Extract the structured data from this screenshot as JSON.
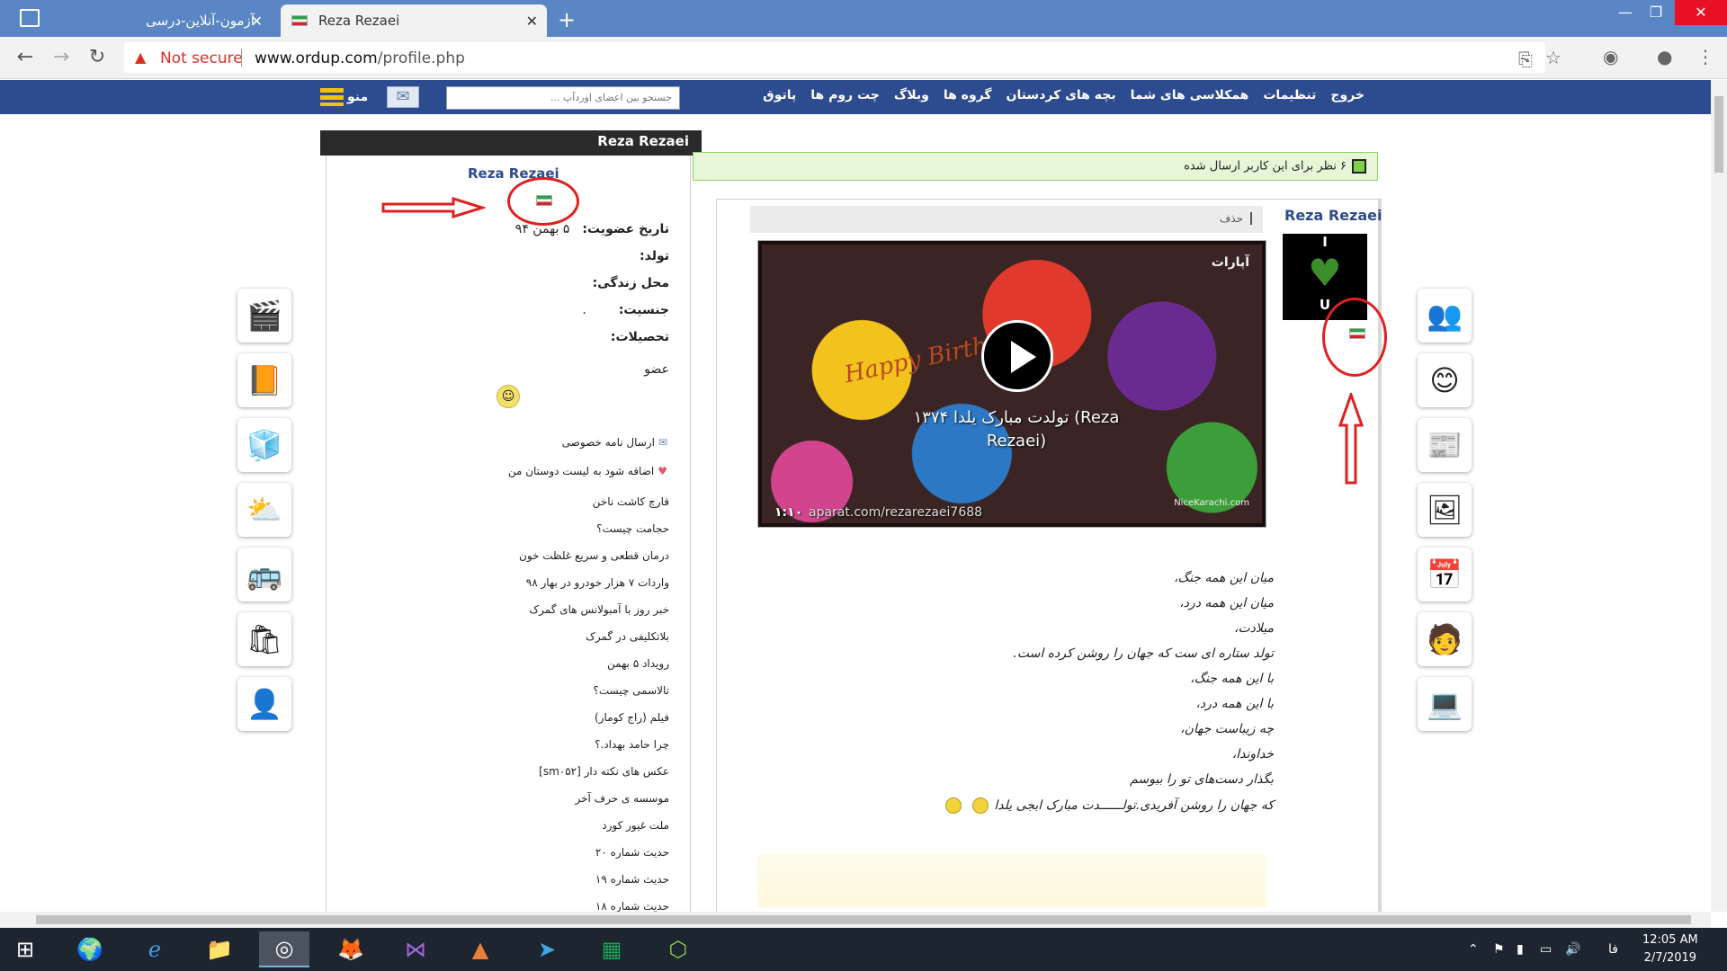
{
  "browser": {
    "tabs": [
      {
        "title": "آزمون-آنلاین-درسی"
      },
      {
        "title": "Reza Rezaei"
      }
    ],
    "security_label": "Not secure",
    "url_host": "www.ordup.com",
    "url_path": "/profile.php"
  },
  "site": {
    "nav_items": [
      "پاتوق",
      "چت روم ها",
      "وبلاگ",
      "گروه ها",
      "بچه های کردستان",
      "همکلاسی های شما",
      "تنظیمات",
      "خروج"
    ],
    "search_placeholder": "جستجو بین اعضای اوردآپ ...",
    "menu_label": "منو"
  },
  "profile": {
    "header_name": "Reza Rezaei",
    "name": "Reza Rezaei",
    "fields": [
      {
        "label": "تاریخ عضویت:",
        "value": "۵ بهمن ۹۴"
      },
      {
        "label": "تولد:",
        "value": ""
      },
      {
        "label": "محل زندگی:",
        "value": ""
      },
      {
        "label": "جنسیت:",
        "value": "."
      },
      {
        "label": "تحصیلات:",
        "value": ""
      }
    ],
    "role": "عضو",
    "send_message": "ارسال نامه خصوصی",
    "add_friend": "اضافه شود به لیست دوستان من",
    "links": [
      "قارچ کاشت ناخن",
      "حجامت چیست؟",
      "درمان قطعی و سریع غلظت خون",
      "واردات ۷ هزار خودرو در بهار ۹۸",
      "خبر روز با آمبولانس های گمرک",
      "بلاتکلیفی در گمرک",
      "رویداد ۵ بهمن",
      "تالاسمی چیست؟",
      "فیلم (راج کومار)",
      "چرا حامد بهداد.؟",
      "عکس های نکته دار [sm۰۵۲]",
      "موسسه ی حرف آخر",
      "ملت غیور کورد",
      "حدیث شماره ۲۰",
      "حدیث شماره ۱۹",
      "حدیث شماره ۱۸"
    ]
  },
  "comments": {
    "notice": "۶ نظر برای این کاربر ارسال شده",
    "author": "Reza Rezaei",
    "avatar_top": "I",
    "avatar_bottom": "U",
    "delete_label": "حذف",
    "video_title": "تولدت مبارک یلدا ۱۳۷۴ (Reza Rezaei)",
    "video_duration": "۱:۱۰",
    "video_watermark": "aparat.com/rezarezaei7688",
    "video_watermark2": "NiceKarachi.com",
    "video_brand": "آپارات",
    "video_banner": "Happy Birthday",
    "poem": [
      "میان این همه جنگ،",
      "میان این همه درد،",
      "میلادت،",
      "تولد ستاره ای ست که جهان را روشن کرده است.",
      "با این همه جنگ،",
      "با این همه درد،",
      "چه زیباست جهان،",
      "خداوندا،",
      "بگذار دست‌های تو را ببوسم",
      "که جهان را روشن آفریدی.تولــــــدت مبارک ابجی یلدا"
    ]
  },
  "taskbar": {
    "lang": "فا",
    "time": "12:05 AM",
    "date": "2/7/2019"
  }
}
